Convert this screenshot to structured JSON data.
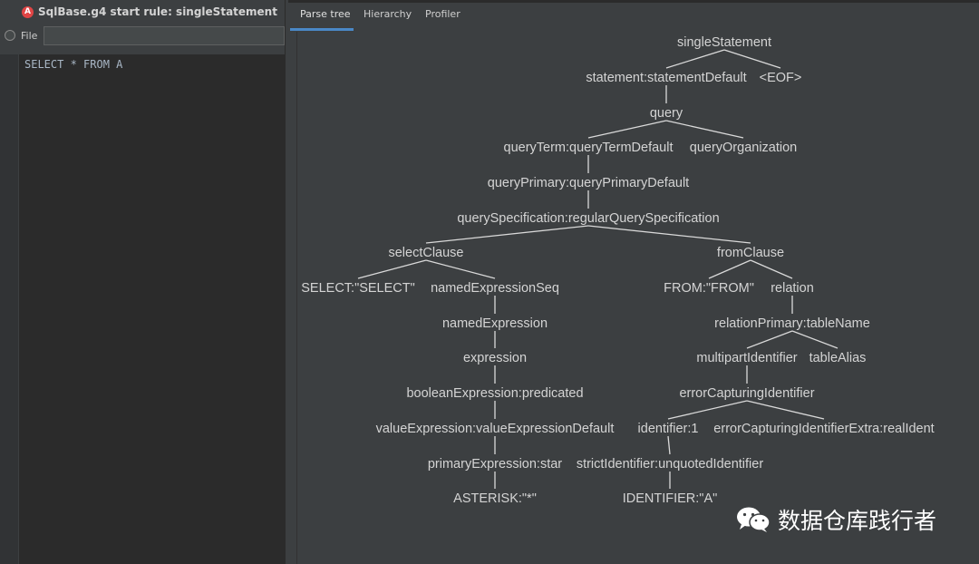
{
  "window": {
    "title": "SqlBase.g4 start rule: singleStatement"
  },
  "file_row": {
    "label": "File",
    "value": ""
  },
  "editor": {
    "line_1": "SELECT * FROM A"
  },
  "tabs": [
    {
      "label": "Parse tree",
      "active": true
    },
    {
      "label": "Hierarchy",
      "active": false
    },
    {
      "label": "Profiler",
      "active": false
    }
  ],
  "tree": {
    "nodes": [
      {
        "id": "n0",
        "label": "singleStatement"
      },
      {
        "id": "n1",
        "label": "statement:statementDefault"
      },
      {
        "id": "n2",
        "label": "<EOF>"
      },
      {
        "id": "n3",
        "label": "query"
      },
      {
        "id": "n4",
        "label": "queryTerm:queryTermDefault"
      },
      {
        "id": "n5",
        "label": "queryOrganization"
      },
      {
        "id": "n6",
        "label": "queryPrimary:queryPrimaryDefault"
      },
      {
        "id": "n7",
        "label": "querySpecification:regularQuerySpecification"
      },
      {
        "id": "n8",
        "label": "selectClause"
      },
      {
        "id": "n9",
        "label": "fromClause"
      },
      {
        "id": "n10",
        "label": "SELECT:\"SELECT\""
      },
      {
        "id": "n11",
        "label": "namedExpressionSeq"
      },
      {
        "id": "n12",
        "label": "FROM:\"FROM\""
      },
      {
        "id": "n13",
        "label": "relation"
      },
      {
        "id": "n14",
        "label": "namedExpression"
      },
      {
        "id": "n15",
        "label": "relationPrimary:tableName"
      },
      {
        "id": "n16",
        "label": "expression"
      },
      {
        "id": "n17",
        "label": "multipartIdentifier"
      },
      {
        "id": "n18",
        "label": "tableAlias"
      },
      {
        "id": "n19",
        "label": "booleanExpression:predicated"
      },
      {
        "id": "n20",
        "label": "errorCapturingIdentifier"
      },
      {
        "id": "n21",
        "label": "valueExpression:valueExpressionDefault"
      },
      {
        "id": "n22",
        "label": "identifier:1"
      },
      {
        "id": "n23",
        "label": "errorCapturingIdentifierExtra:realIdent"
      },
      {
        "id": "n24",
        "label": "primaryExpression:star"
      },
      {
        "id": "n25",
        "label": "strictIdentifier:unquotedIdentifier"
      },
      {
        "id": "n26",
        "label": "ASTERISK:\"*\""
      },
      {
        "id": "n27",
        "label": "IDENTIFIER:\"A\""
      }
    ],
    "edges": [
      [
        "n0",
        "n1"
      ],
      [
        "n0",
        "n2"
      ],
      [
        "n1",
        "n3"
      ],
      [
        "n3",
        "n4"
      ],
      [
        "n3",
        "n5"
      ],
      [
        "n4",
        "n6"
      ],
      [
        "n6",
        "n7"
      ],
      [
        "n7",
        "n8"
      ],
      [
        "n7",
        "n9"
      ],
      [
        "n8",
        "n10"
      ],
      [
        "n8",
        "n11"
      ],
      [
        "n9",
        "n12"
      ],
      [
        "n9",
        "n13"
      ],
      [
        "n11",
        "n14"
      ],
      [
        "n13",
        "n15"
      ],
      [
        "n14",
        "n16"
      ],
      [
        "n15",
        "n17"
      ],
      [
        "n15",
        "n18"
      ],
      [
        "n16",
        "n19"
      ],
      [
        "n17",
        "n20"
      ],
      [
        "n19",
        "n21"
      ],
      [
        "n20",
        "n22"
      ],
      [
        "n20",
        "n23"
      ],
      [
        "n21",
        "n24"
      ],
      [
        "n22",
        "n25"
      ],
      [
        "n24",
        "n26"
      ],
      [
        "n25",
        "n27"
      ]
    ]
  },
  "watermark": {
    "text": "数据仓库践行者",
    "logo_icon": "wechat-icon"
  },
  "colors": {
    "error_icon": "#e04545",
    "tab_underline": "#4a88c7",
    "tree_text": "#d4d4d4"
  }
}
